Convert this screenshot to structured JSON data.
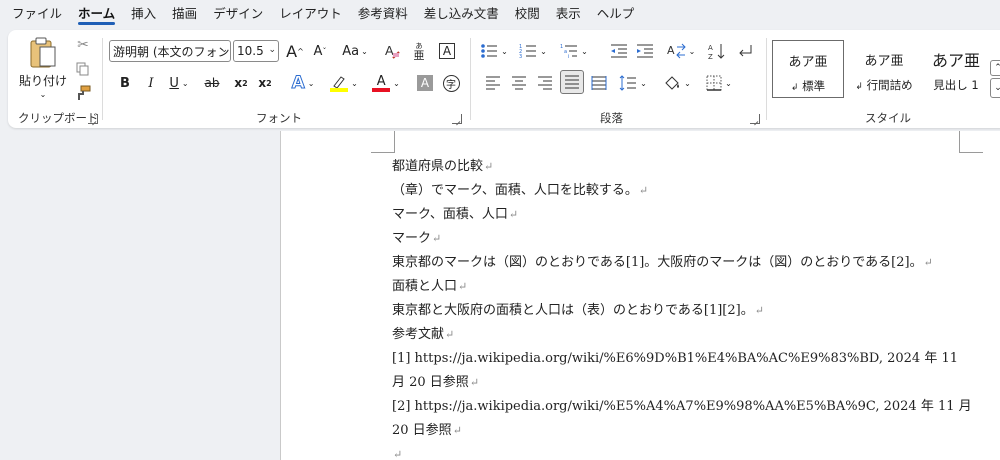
{
  "menu": [
    "ファイル",
    "ホーム",
    "挿入",
    "描画",
    "デザイン",
    "レイアウト",
    "参考資料",
    "差し込み文書",
    "校閲",
    "表示",
    "ヘルプ"
  ],
  "active_tab": "ホーム",
  "clipboard": {
    "paste_label": "貼り付け",
    "group_label": "クリップボード"
  },
  "font": {
    "name": "游明朝 (本文のフォン",
    "size": "10.5",
    "bold": "B",
    "italic": "I",
    "underline": "U",
    "strike": "ab",
    "subscript": "x",
    "superscript": "x",
    "change_case": "Aa",
    "grow": "A",
    "shrink": "A",
    "group_label": "フォント"
  },
  "paragraph": {
    "group_label": "段落"
  },
  "styles": {
    "group_label": "スタイル",
    "items": [
      {
        "sample": "あア亜",
        "name": "標準"
      },
      {
        "sample": "あア亜",
        "name": "行間詰め"
      },
      {
        "sample": "あア亜",
        "name": "見出し 1"
      }
    ]
  },
  "document": {
    "lines": [
      "都道府県の比較",
      "（章）でマーク、面積、人口を比較する。",
      "マーク、面積、人口",
      "マーク",
      "東京都のマークは（図）のとおりである[1]。大阪府のマークは（図）のとおりである[2]。",
      "面積と人口",
      "東京都と大阪府の面積と人口は（表）のとおりである[1][2]。",
      "参考文献",
      "[1] https://ja.wikipedia.org/wiki/%E6%9D%B1%E4%BA%AC%E9%83%BD, 2024 年 11",
      "月 20 日参照",
      "[2] https://ja.wikipedia.org/wiki/%E5%A4%A7%E9%98%AA%E5%BA%9C, 2024 年 11 月",
      "20 日参照",
      ""
    ]
  },
  "colors": {
    "accent": "#1f5fb6",
    "highlight": "#ffff00",
    "font_color": "#e81123"
  }
}
